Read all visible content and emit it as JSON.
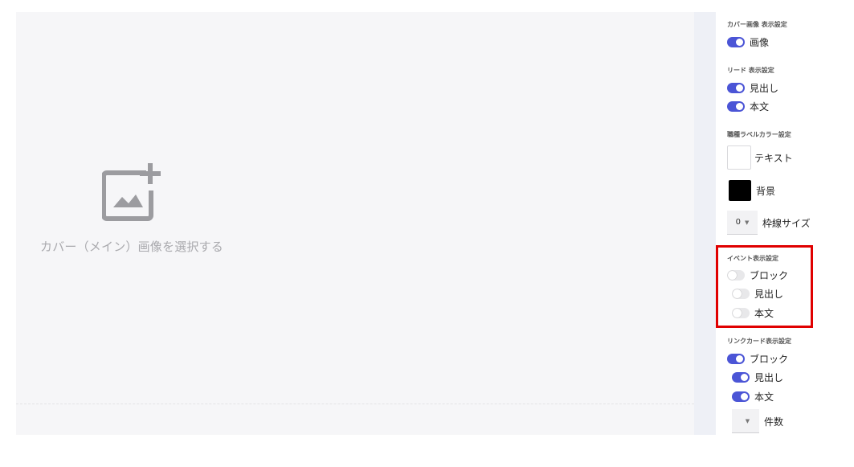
{
  "canvas": {
    "cover_hint": "カバー（メイン）画像を選択する",
    "icon": "add-image-icon"
  },
  "panel": {
    "cover": {
      "title": "カバー画像 表示設定",
      "image_label": "画像",
      "image_on": true
    },
    "lead": {
      "title": "リード 表示設定",
      "heading_label": "見出し",
      "body_label": "本文"
    },
    "label_color": {
      "title": "職種ラベルカラー設定",
      "text_label": "テキスト",
      "text_color": "#ffffff",
      "bg_label": "背景",
      "bg_color": "#000000",
      "border_value": "0",
      "border_label": "枠線サイズ"
    },
    "event": {
      "title": "イベント表示設定",
      "block_label": "ブロック",
      "heading_label": "見出し",
      "body_label": "本文"
    },
    "link_card": {
      "title": "リンクカード表示設定",
      "block_label": "ブロック",
      "heading_label": "見出し",
      "body_label": "本文",
      "count_value": "",
      "count_label": "件数"
    }
  },
  "colors": {
    "accent": "#4b55d6",
    "highlight": "#e00000"
  }
}
